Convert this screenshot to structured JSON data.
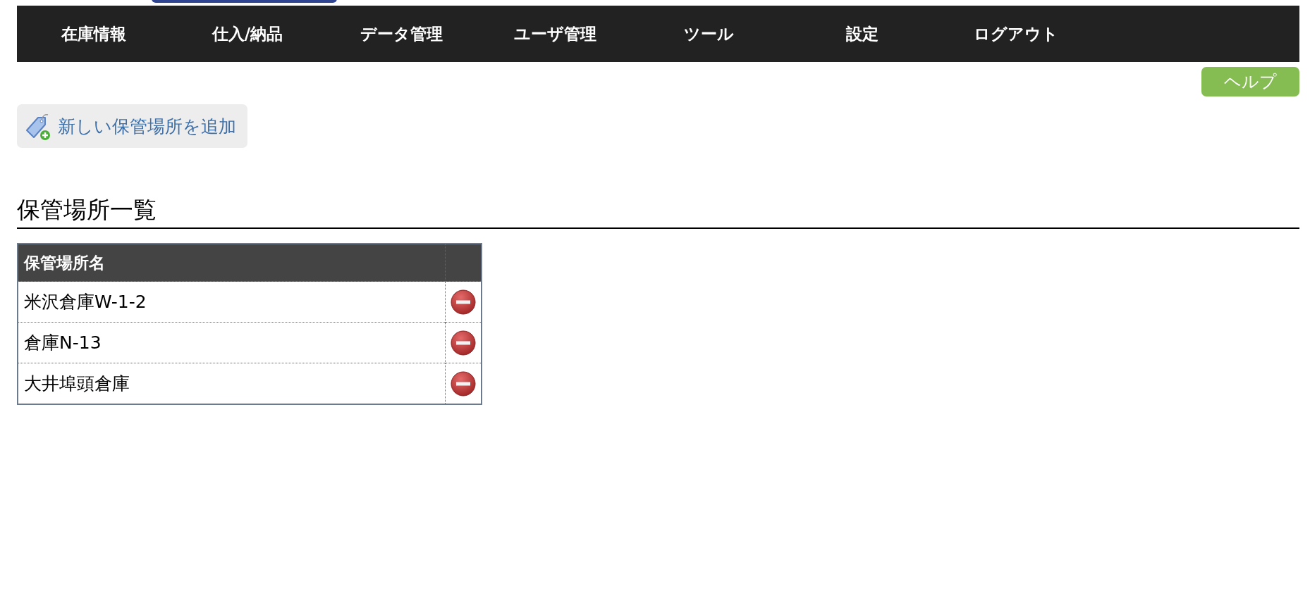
{
  "nav": [
    {
      "label": "在庫情報"
    },
    {
      "label": "仕入/納品"
    },
    {
      "label": "データ管理"
    },
    {
      "label": "ユーザ管理"
    },
    {
      "label": "ツール"
    },
    {
      "label": "設定"
    },
    {
      "label": "ログアウト"
    }
  ],
  "help_button": "ヘルプ",
  "add_button": "新しい保管場所を追加",
  "section_title": "保管場所一覧",
  "table": {
    "columns": [
      "保管場所名"
    ],
    "rows": [
      {
        "name": "米沢倉庫W-1-2"
      },
      {
        "name": "倉庫N-13"
      },
      {
        "name": "大井埠頭倉庫"
      }
    ]
  }
}
